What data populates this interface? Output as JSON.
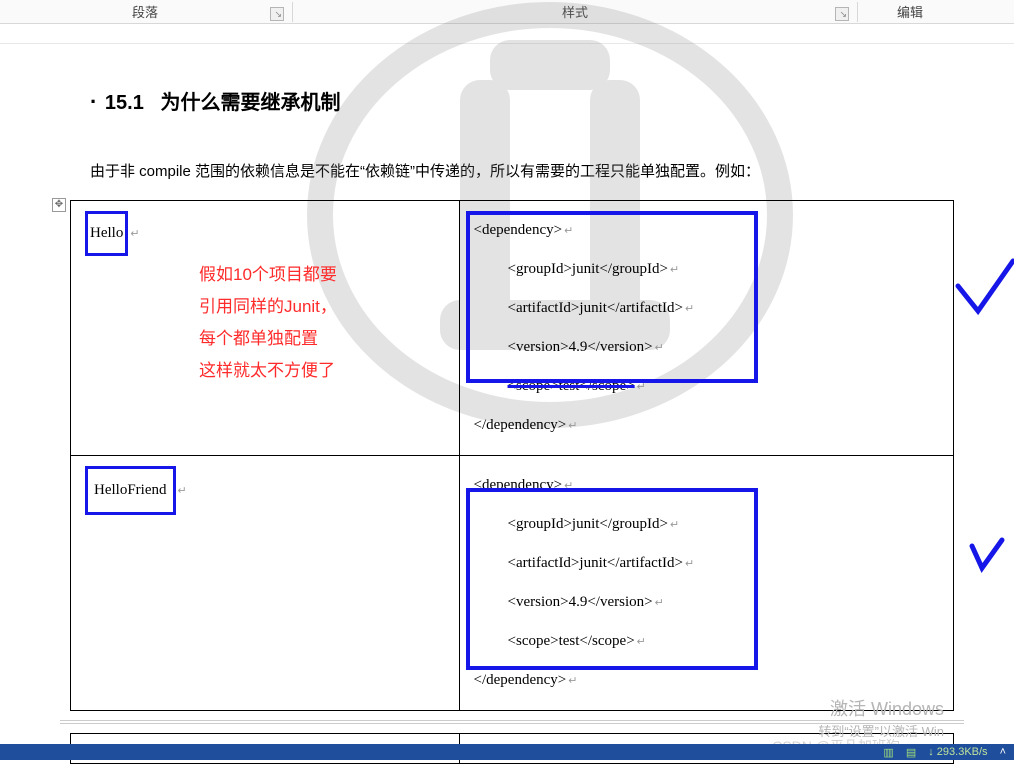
{
  "ribbon": {
    "group_paragraph": "段落",
    "group_styles": "样式",
    "group_editing": "编辑"
  },
  "document": {
    "heading_number": "15.1",
    "heading_text": "为什么需要继承机制",
    "intro_paragraph": "由于非 compile 范围的依赖信息是不能在“依赖链”中传递的，所以有需要的工程只能单独配置。例如：",
    "annotation_lines": [
      "假如10个项目都要",
      "引用同样的Junit，",
      "每个都单独配置",
      "这样就太不方便了"
    ],
    "table": {
      "rows": [
        {
          "left": "Hello",
          "right": {
            "open": "<dependency>",
            "groupId": "<groupId>junit</groupId>",
            "artifactId": "<artifactId>junit</artifactId>",
            "version": "<version>4.9</version>",
            "scope": "<scope>test</scope>",
            "close": "</dependency>"
          }
        },
        {
          "left": "HelloFriend",
          "right": {
            "open": "<dependency>",
            "groupId": "<groupId>junit</groupId>",
            "artifactId": "<artifactId>junit</artifactId>",
            "version": "<version>4.9</version>",
            "scope": "<scope>test</scope>",
            "close": "</dependency>"
          }
        }
      ]
    },
    "csdn": "CSDN @平凡加班狗",
    "activate_title": "激活 Windows",
    "activate_sub": "转到“设置”以激活 Win"
  },
  "taskbar": {
    "netrate": "293.3KB/s"
  }
}
